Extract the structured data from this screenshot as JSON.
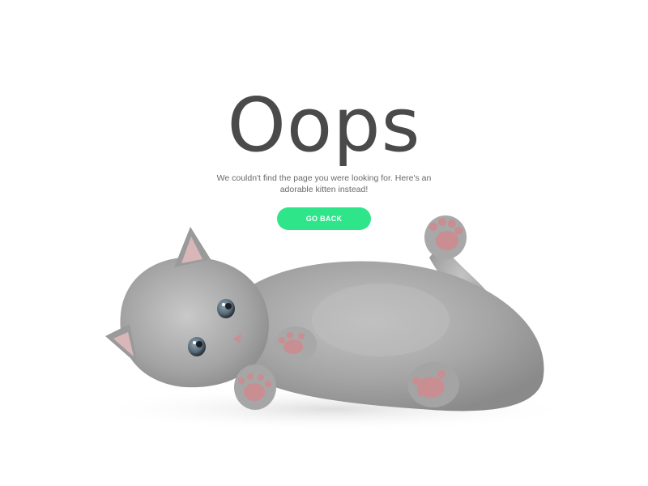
{
  "error_page": {
    "headline": "Oops",
    "message": "We couldn't find the page you were looking for. Here's an adorable kitten instead!",
    "go_back_label": "GO BACK"
  },
  "colors": {
    "headline": "#4a4a4a",
    "message": "#6a6a6a",
    "button_background": "#2ee58a",
    "button_text": "#ffffff",
    "kitten_fur": "#a3a3a3",
    "kitten_paw_pads": "#c98e92",
    "background": "#ffffff"
  },
  "kitten_image": {
    "icon": "kitten-illustration"
  }
}
